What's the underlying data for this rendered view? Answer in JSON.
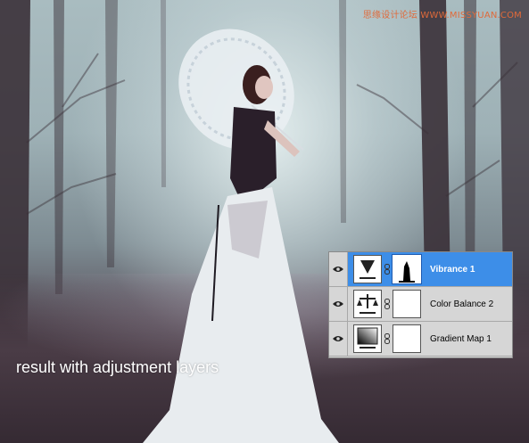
{
  "watermark": "思缘设计论坛 WWW.MISSYUAN.COM",
  "caption": "result with adjustment layers",
  "layers_panel": {
    "layers": [
      {
        "name": "Vibrance 1",
        "icon": "vibrance-icon",
        "selected": true
      },
      {
        "name": "Color Balance 2",
        "icon": "color-balance-icon",
        "selected": false
      },
      {
        "name": "Gradient Map 1",
        "icon": "gradient-map-icon",
        "selected": false
      }
    ]
  },
  "colors": {
    "selection": "#3d8ee8",
    "panel_bg": "#d6d6d6",
    "watermark": "#e06a3a"
  }
}
